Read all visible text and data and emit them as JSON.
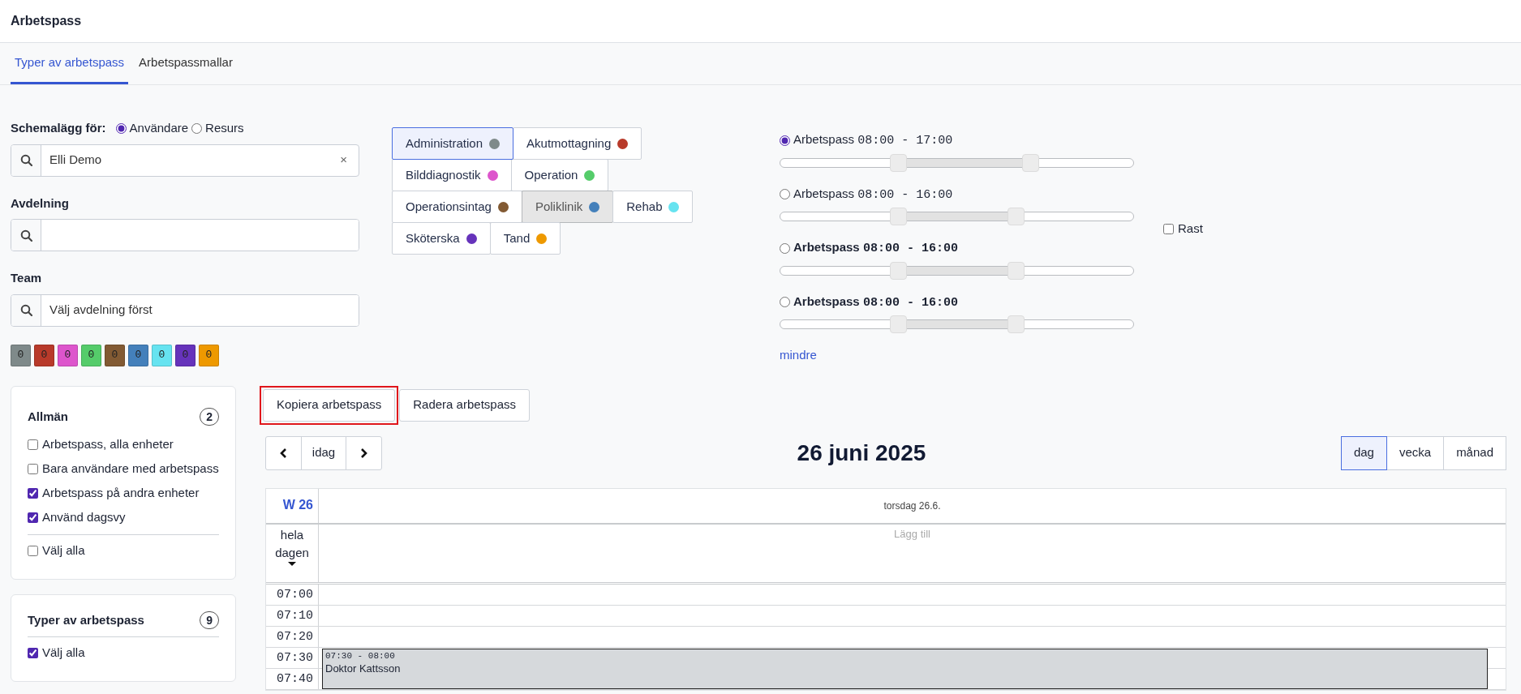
{
  "header": {
    "title": "Arbetspass"
  },
  "tabs": [
    {
      "label": "Typer av arbetspass",
      "selected": true
    },
    {
      "label": "Arbetspassmallar",
      "selected": false
    }
  ],
  "schedule_for": {
    "label": "Schemalägg för:",
    "options": [
      {
        "label": "Användare",
        "selected": true
      },
      {
        "label": "Resurs",
        "selected": false
      }
    ]
  },
  "user_field": {
    "value": "Elli Demo",
    "clear": "×"
  },
  "department": {
    "label": "Avdelning"
  },
  "team": {
    "label": "Team",
    "value": "Välj avdelning först"
  },
  "counters": [
    {
      "count": "0",
      "color": "#7f8a8a"
    },
    {
      "count": "0",
      "color": "#b83a2a"
    },
    {
      "count": "0",
      "color": "#dd55cc"
    },
    {
      "count": "0",
      "color": "#55cc6a"
    },
    {
      "count": "0",
      "color": "#825a33"
    },
    {
      "count": "0",
      "color": "#4480bb"
    },
    {
      "count": "0",
      "color": "#66e3f0"
    },
    {
      "count": "0",
      "color": "#6633bb"
    },
    {
      "count": "0",
      "color": "#ee9900"
    }
  ],
  "shift_types": [
    {
      "name": "Administration",
      "color": "#7f8a8a",
      "selected": true,
      "pressed": false
    },
    {
      "name": "Akutmottagning",
      "color": "#b83a2a",
      "selected": false,
      "pressed": false
    },
    {
      "name": "Bilddiagnostik",
      "color": "#dd55cc",
      "selected": false,
      "pressed": false
    },
    {
      "name": "Operation",
      "color": "#55cc6a",
      "selected": false,
      "pressed": false
    },
    {
      "name": "Operationsintag",
      "color": "#825a33",
      "selected": false,
      "pressed": false
    },
    {
      "name": "Poliklinik",
      "color": "#4480bb",
      "selected": false,
      "pressed": true
    },
    {
      "name": "Rehab",
      "color": "#66e3f0",
      "selected": false,
      "pressed": false
    },
    {
      "name": "Sköterska",
      "color": "#6633bb",
      "selected": false,
      "pressed": false
    },
    {
      "name": "Tand",
      "color": "#ee9900",
      "selected": false,
      "pressed": false
    }
  ],
  "shifts": [
    {
      "name": "Arbetspass",
      "time": "08:00 - 17:00",
      "selected": true,
      "emphasized": false,
      "thumbs": [
        {
          "level": 0.333
        },
        {
          "level": 0.708
        }
      ]
    },
    {
      "name": "Arbetspass",
      "time": "08:00 - 16:00",
      "selected": false,
      "emphasized": false,
      "thumbs": [
        {
          "level": 0.333
        },
        {
          "level": 0.667
        }
      ]
    },
    {
      "name": "Arbetspass",
      "time": "08:00 - 16:00",
      "selected": false,
      "emphasized": true,
      "thumbs": [
        {
          "level": 0.333
        },
        {
          "level": 0.667
        }
      ]
    },
    {
      "name": "Arbetspass",
      "time": "08:00 - 16:00",
      "selected": false,
      "emphasized": true,
      "thumbs": [
        {
          "level": 0.333
        },
        {
          "level": 0.667
        }
      ]
    }
  ],
  "less_link": "mindre",
  "break_option": {
    "label": "Rast",
    "checked": false
  },
  "filter_groups": [
    {
      "title": "Allmän",
      "count": "2",
      "items": [
        {
          "kind": "option",
          "label": "Arbetspass, alla enheter",
          "checked": false
        },
        {
          "kind": "option",
          "label": "Bara användare med arbetspass",
          "checked": false
        },
        {
          "kind": "option",
          "label": "Arbetspass på andra enheter",
          "checked": true
        },
        {
          "kind": "option",
          "label": "Använd dagsvy",
          "checked": true
        },
        {
          "kind": "select_all",
          "label": "Välj alla",
          "checked": false
        }
      ]
    },
    {
      "title": "Typer av arbetspass",
      "count": "9",
      "items": [
        {
          "kind": "select_all",
          "label": "Välj alla",
          "checked": true
        }
      ]
    }
  ],
  "actions": [
    {
      "label": "Kopiera arbetspass",
      "highlighted": true
    },
    {
      "label": "Radera arbetspass",
      "highlighted": false
    }
  ],
  "navigation": {
    "today": "idag"
  },
  "calendar": {
    "title": "26 juni 2025",
    "views": [
      {
        "label": "dag",
        "selected": true
      },
      {
        "label": "vecka",
        "selected": false
      },
      {
        "label": "månad",
        "selected": false
      }
    ],
    "week": "W 26",
    "day": "torsdag 26.6.",
    "all_day": {
      "label": "hela dagen",
      "hint": "Lägg till"
    },
    "time_slots": [
      {
        "time": "07:00"
      },
      {
        "time": "07:10"
      },
      {
        "time": "07:20"
      },
      {
        "time": "07:30",
        "event": {
          "time": "07:30 - 08:00",
          "title": "Doktor Kattsson"
        }
      },
      {
        "time": "07:40"
      }
    ]
  }
}
